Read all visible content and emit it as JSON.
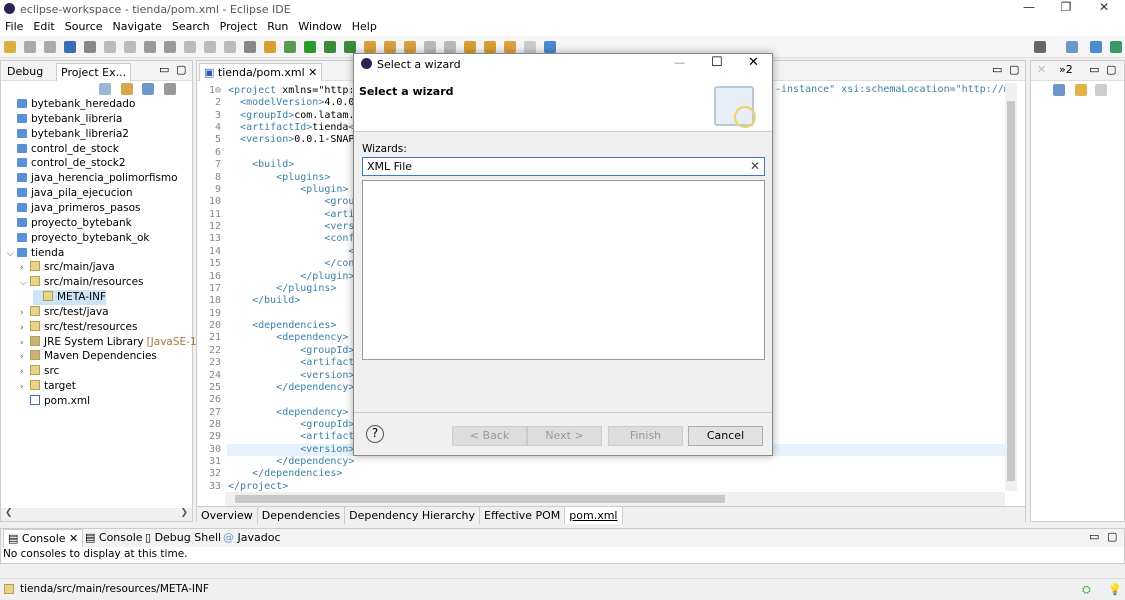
{
  "window": {
    "title": "eclipse-workspace - tienda/pom.xml - Eclipse IDE",
    "minimize": "—",
    "restore": "❐",
    "close": "✕"
  },
  "menu": [
    "File",
    "Edit",
    "Source",
    "Navigate",
    "Search",
    "Project",
    "Run",
    "Window",
    "Help"
  ],
  "left_panel": {
    "tabs": [
      "Debug",
      "Project Ex..."
    ],
    "tree": [
      {
        "label": "bytebank_heredado",
        "depth": 0,
        "kind": "project"
      },
      {
        "label": "bytebank_libreria",
        "depth": 0,
        "kind": "project"
      },
      {
        "label": "bytebank_libreria2",
        "depth": 0,
        "kind": "project"
      },
      {
        "label": "control_de_stock",
        "depth": 0,
        "kind": "project"
      },
      {
        "label": "control_de_stock2",
        "depth": 0,
        "kind": "project"
      },
      {
        "label": "java_herencia_polimorfismo",
        "depth": 0,
        "kind": "project"
      },
      {
        "label": "java_pila_ejecucion",
        "depth": 0,
        "kind": "project"
      },
      {
        "label": "java_primeros_pasos",
        "depth": 0,
        "kind": "project"
      },
      {
        "label": "proyecto_bytebank",
        "depth": 0,
        "kind": "project"
      },
      {
        "label": "proyecto_bytebank_ok",
        "depth": 0,
        "kind": "project"
      },
      {
        "label": "tienda",
        "depth": 0,
        "kind": "project",
        "arrow": "expanded"
      },
      {
        "label": "src/main/java",
        "depth": 1,
        "kind": "folder",
        "arrow": "collapsed"
      },
      {
        "label": "src/main/resources",
        "depth": 1,
        "kind": "folder",
        "arrow": "expanded"
      },
      {
        "label": "META-INF",
        "depth": 2,
        "kind": "folder",
        "selected": true
      },
      {
        "label": "src/test/java",
        "depth": 1,
        "kind": "folder",
        "arrow": "collapsed"
      },
      {
        "label": "src/test/resources",
        "depth": 1,
        "kind": "folder",
        "arrow": "collapsed"
      },
      {
        "label": "JRE System Library",
        "suffix": "[JavaSE-11]",
        "depth": 1,
        "kind": "library",
        "arrow": "collapsed"
      },
      {
        "label": "Maven Dependencies",
        "depth": 1,
        "kind": "library",
        "arrow": "collapsed"
      },
      {
        "label": "src",
        "depth": 1,
        "kind": "folder",
        "arrow": "collapsed"
      },
      {
        "label": "target",
        "depth": 1,
        "kind": "folder",
        "arrow": "collapsed"
      },
      {
        "label": "pom.xml",
        "depth": 1,
        "kind": "file"
      }
    ]
  },
  "editor": {
    "tab": "tienda/pom.xml",
    "line1_right": "-instance\" xsi:schemaLocation=\"http://ma",
    "lines": [
      "<project xmlns=\"http:/",
      "  <modelVersion>4.0.0<",
      "  <groupId>com.latam.a",
      "  <artifactId>tienda</",
      "  <version>0.0.1-SNAPS",
      "",
      "    <build>",
      "        <plugins>",
      "            <plugin>",
      "                <group",
      "                <artif",
      "                <versi",
      "                <confi",
      "                    <r",
      "                </conf",
      "            </plugin>",
      "        </plugins>",
      "    </build>",
      "",
      "    <dependencies>",
      "        <dependency>",
      "            <groupId>c",
      "            <artifactI",
      "            <version>5",
      "        </dependency>",
      "",
      "        <dependency>",
      "            <groupId>c",
      "            <artifactI",
      "            <version>2",
      "        </dependency>",
      "    </dependencies>",
      "</project>"
    ],
    "highlighted_line": 30,
    "bottom_tabs": [
      "Overview",
      "Dependencies",
      "Dependency Hierarchy",
      "Effective POM",
      "pom.xml"
    ],
    "active_bottom_tab": "pom.xml"
  },
  "right_panel": {
    "overflow": "»2"
  },
  "console": {
    "tabs": [
      "Console",
      "Console",
      "Debug Shell",
      "Javadoc"
    ],
    "message": "No consoles to display at this time."
  },
  "status": {
    "path": "tienda/src/main/resources/META-INF"
  },
  "dialog": {
    "title": "Select a wizard",
    "heading": "Select a wizard",
    "label": "Wizards:",
    "filter_value": "XML File",
    "buttons": {
      "back": "< Back",
      "next": "Next >",
      "finish": "Finish",
      "cancel": "Cancel"
    },
    "help": "?"
  }
}
